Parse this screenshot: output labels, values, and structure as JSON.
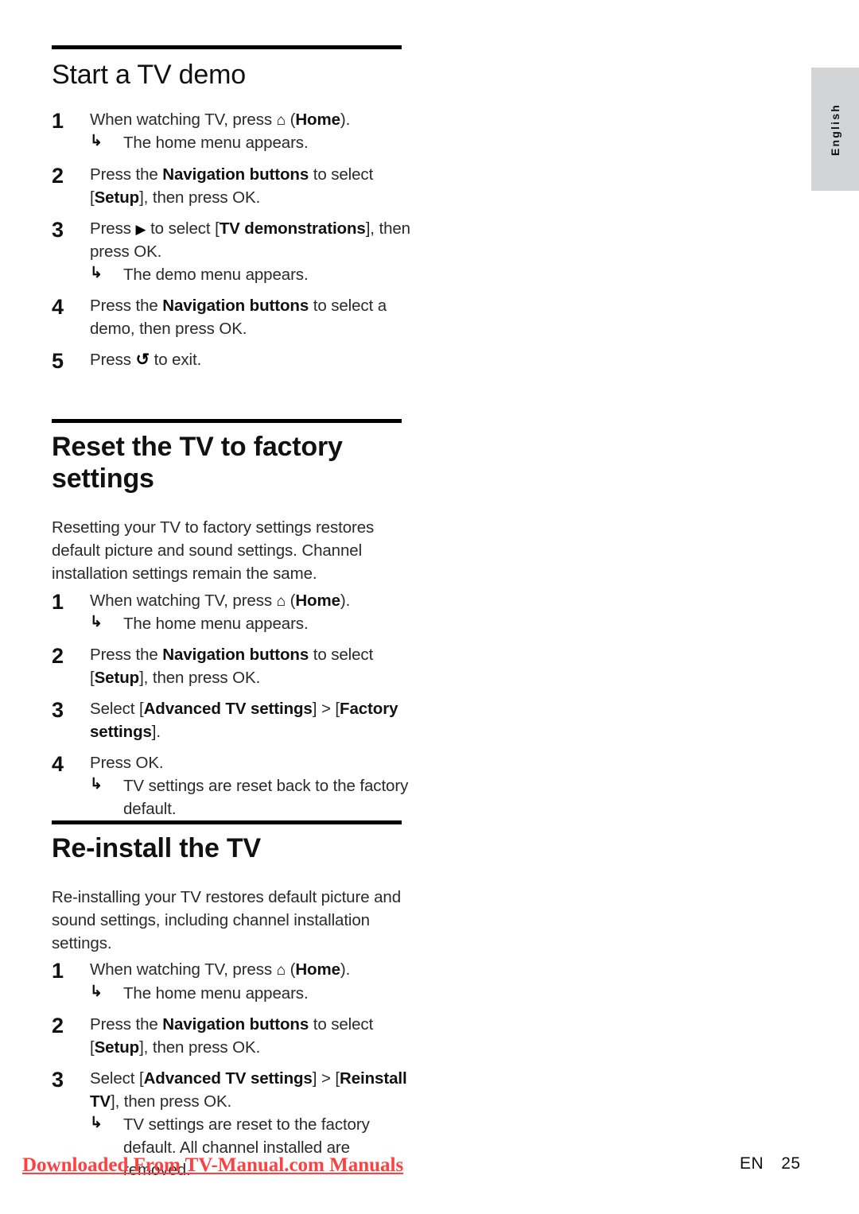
{
  "page": {
    "language_tab": "English",
    "footer": {
      "watermark": "Downloaded From TV-Manual.com Manuals",
      "lang_code": "EN",
      "page_number": "25"
    },
    "colors": {
      "watermark": "#ff4040",
      "tab_background": "#d2d4d6",
      "rule": "#000000",
      "text": "#2a2a2a"
    }
  },
  "glyphs": {
    "home": "⌂",
    "home_name": "home-icon",
    "right": "▶",
    "right_name": "right-arrow-icon",
    "back": "↺",
    "back_name": "back-icon",
    "hook": "↳",
    "hook_name": "result-hook-arrow-icon"
  },
  "sections": [
    {
      "heading": "Start a TV demo",
      "heading_weight": "light",
      "intro": null,
      "steps": [
        {
          "num": "1",
          "parts": [
            {
              "t": "When watching TV, press ",
              "b": false
            },
            {
              "t": "⌂",
              "glyph": "home"
            },
            {
              "t": " (",
              "b": false
            },
            {
              "t": "Home",
              "b": true
            },
            {
              "t": ").",
              "b": false
            }
          ],
          "result": "The home menu appears."
        },
        {
          "num": "2",
          "parts": [
            {
              "t": "Press the ",
              "b": false
            },
            {
              "t": "Navigation buttons",
              "b": true
            },
            {
              "t": " to select [",
              "b": false
            },
            {
              "t": "Setup",
              "b": true
            },
            {
              "t": "], then press OK.",
              "b": false
            }
          ],
          "result": null
        },
        {
          "num": "3",
          "parts": [
            {
              "t": "Press ",
              "b": false
            },
            {
              "t": "▶",
              "glyph": "right"
            },
            {
              "t": " to select [",
              "b": false
            },
            {
              "t": "TV demonstrations",
              "b": true
            },
            {
              "t": "], then press OK.",
              "b": false
            }
          ],
          "result": "The demo menu appears."
        },
        {
          "num": "4",
          "parts": [
            {
              "t": "Press the ",
              "b": false
            },
            {
              "t": "Navigation buttons",
              "b": true
            },
            {
              "t": " to select a demo, then press OK.",
              "b": false
            }
          ],
          "result": null
        },
        {
          "num": "5",
          "parts": [
            {
              "t": "Press ",
              "b": false
            },
            {
              "t": "↺",
              "glyph": "back"
            },
            {
              "t": " to exit.",
              "b": false
            }
          ],
          "result": null
        }
      ]
    },
    {
      "heading": "Reset the TV to factory settings",
      "heading_weight": "semibold",
      "intro": "Resetting your TV to factory settings restores default picture and sound settings. Channel installation settings remain the same.",
      "steps": [
        {
          "num": "1",
          "parts": [
            {
              "t": "When watching TV, press ",
              "b": false
            },
            {
              "t": "⌂",
              "glyph": "home"
            },
            {
              "t": " (",
              "b": false
            },
            {
              "t": "Home",
              "b": true
            },
            {
              "t": ").",
              "b": false
            }
          ],
          "result": "The home menu appears."
        },
        {
          "num": "2",
          "parts": [
            {
              "t": "Press the ",
              "b": false
            },
            {
              "t": "Navigation buttons",
              "b": true
            },
            {
              "t": " to select [",
              "b": false
            },
            {
              "t": "Setup",
              "b": true
            },
            {
              "t": "], then press OK.",
              "b": false
            }
          ],
          "result": null
        },
        {
          "num": "3",
          "parts": [
            {
              "t": "Select [",
              "b": false
            },
            {
              "t": "Advanced TV settings",
              "b": true
            },
            {
              "t": "] > [",
              "b": false
            },
            {
              "t": "Factory settings",
              "b": true
            },
            {
              "t": "].",
              "b": false
            }
          ],
          "result": null
        },
        {
          "num": "4",
          "parts": [
            {
              "t": "Press OK.",
              "b": false
            }
          ],
          "result": "TV settings are reset back to the factory default."
        }
      ]
    },
    {
      "heading": "Re-install the TV",
      "heading_weight": "semibold",
      "intro": "Re-installing your TV restores default picture and sound settings, including channel installation settings.",
      "steps": [
        {
          "num": "1",
          "parts": [
            {
              "t": "When watching TV, press ",
              "b": false
            },
            {
              "t": "⌂",
              "glyph": "home"
            },
            {
              "t": " (",
              "b": false
            },
            {
              "t": "Home",
              "b": true
            },
            {
              "t": ").",
              "b": false
            }
          ],
          "result": "The home menu appears."
        },
        {
          "num": "2",
          "parts": [
            {
              "t": "Press the ",
              "b": false
            },
            {
              "t": "Navigation buttons",
              "b": true
            },
            {
              "t": " to select [",
              "b": false
            },
            {
              "t": "Setup",
              "b": true
            },
            {
              "t": "], then press OK.",
              "b": false
            }
          ],
          "result": null
        },
        {
          "num": "3",
          "parts": [
            {
              "t": "Select [",
              "b": false
            },
            {
              "t": "Advanced TV settings",
              "b": true
            },
            {
              "t": "] > [",
              "b": false
            },
            {
              "t": "Reinstall TV",
              "b": true
            },
            {
              "t": "], then press OK.",
              "b": false
            }
          ],
          "result": "TV settings are reset to the factory default. All channel installed are removed."
        }
      ]
    }
  ]
}
